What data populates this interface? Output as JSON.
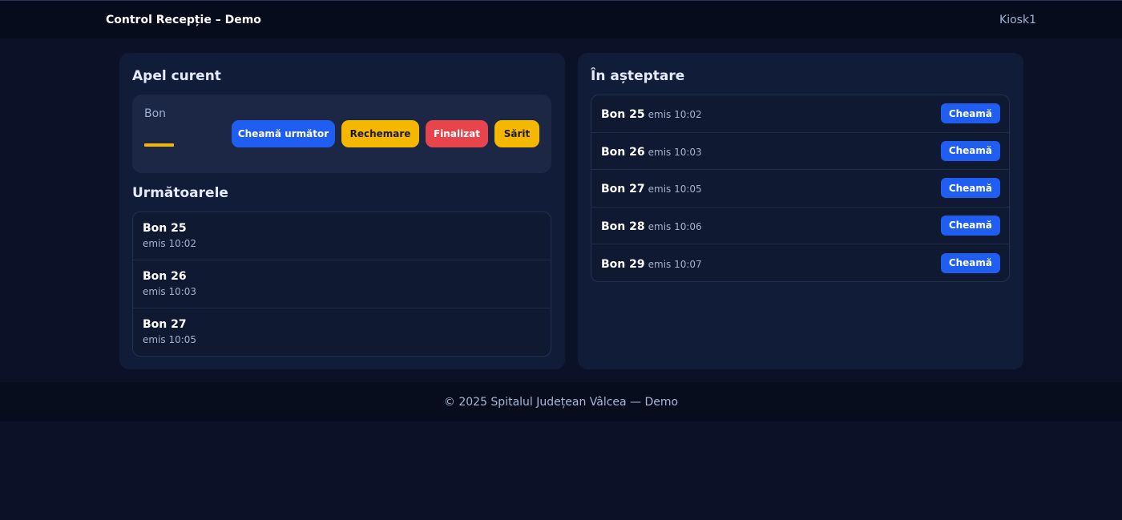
{
  "header": {
    "title": "Control Recepție – Demo",
    "kiosk": "Kiosk1"
  },
  "current_call": {
    "heading": "Apel curent",
    "label": "Bon",
    "number_placeholder": "—",
    "buttons": {
      "call_next": "Cheamă următor",
      "recall": "Rechemare",
      "finish": "Finalizat",
      "skip": "Sărit"
    }
  },
  "next": {
    "heading": "Următoarele",
    "items": [
      {
        "bon": "Bon 25",
        "emis": "emis 10:02"
      },
      {
        "bon": "Bon 26",
        "emis": "emis 10:03"
      },
      {
        "bon": "Bon 27",
        "emis": "emis 10:05"
      }
    ]
  },
  "waiting": {
    "heading": "În așteptare",
    "call_label": "Cheamă",
    "items": [
      {
        "bon": "Bon 25",
        "emis": "emis 10:02"
      },
      {
        "bon": "Bon 26",
        "emis": "emis 10:03"
      },
      {
        "bon": "Bon 27",
        "emis": "emis 10:05"
      },
      {
        "bon": "Bon 28",
        "emis": "emis 10:06"
      },
      {
        "bon": "Bon 29",
        "emis": "emis 10:07"
      }
    ]
  },
  "footer": {
    "text": "© 2025 Spitalul Județean Vâlcea — Demo"
  },
  "colors": {
    "accent_blue": "#1f5ef0",
    "warning_yellow": "#f5b700",
    "danger_red": "#e8444b"
  }
}
